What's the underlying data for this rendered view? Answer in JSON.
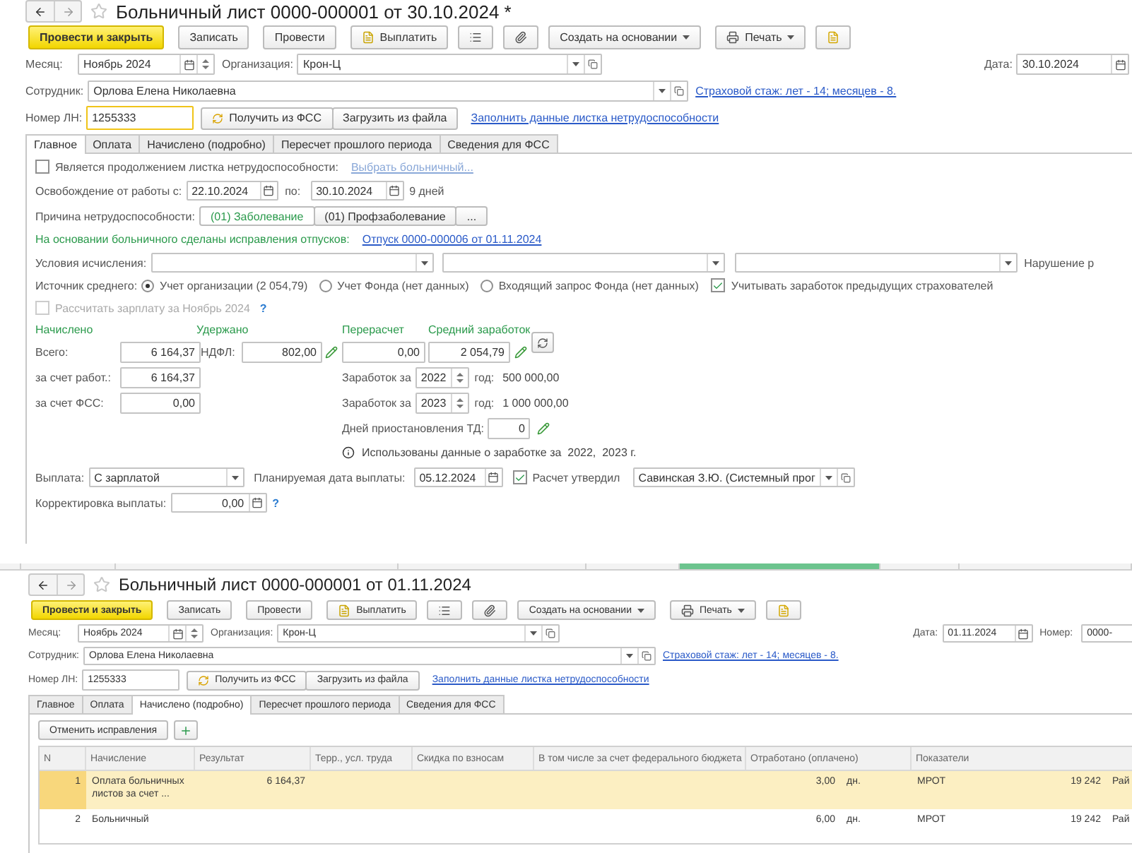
{
  "documents": [
    {
      "title": "Больничный лист 0000-000001 от 30.10.2024 *",
      "toolbar": [
        {
          "kind": "primary",
          "label": "Провести и закрыть"
        },
        {
          "kind": "button",
          "label": "Записать"
        },
        {
          "kind": "button",
          "label": "Провести"
        },
        {
          "kind": "pay",
          "label": "Выплатить"
        },
        {
          "kind": "list"
        },
        {
          "kind": "clip"
        },
        {
          "kind": "menu",
          "label": "Создать на основании"
        },
        {
          "kind": "print",
          "label": "Печать"
        },
        {
          "kind": "report"
        }
      ],
      "month": {
        "label": "Месяц:",
        "value": "Ноябрь 2024"
      },
      "organization": {
        "label": "Организация:",
        "value": "Крон-Ц"
      },
      "date": {
        "label": "Дата:",
        "value": "30.10.2024"
      },
      "employee": {
        "label": "Сотрудник:",
        "value": "Орлова Елена Николаевна"
      },
      "insurance_link": "Страховой стаж: лет - 14; месяцев - 8.",
      "sick_number": {
        "label": "Номер ЛН:",
        "value": "1255333",
        "focused": true
      },
      "fss_button": "Получить из ФСС",
      "file_button": "Загрузить из файла",
      "fill_link": "Заполнить данные листка нетрудоспособности",
      "tabs": [
        {
          "label": "Главное",
          "selected": true
        },
        {
          "label": "Оплата",
          "selected": false
        },
        {
          "label": "Начислено (подробно)",
          "selected": false
        },
        {
          "label": "Пересчет прошлого периода",
          "selected": false
        },
        {
          "label": "Сведения для ФСС",
          "selected": false
        }
      ],
      "main": {
        "continuation": {
          "label": "Является продолжением листка нетрудоспособности:",
          "checked": false,
          "link": "Выбрать больничный..."
        },
        "release": {
          "label": "Освобождение от работы с:",
          "from": "22.10.2024",
          "to_label": "по:",
          "to": "30.10.2024",
          "days": "9 дней"
        },
        "cause": {
          "label": "Причина нетрудоспособности:",
          "options": [
            {
              "label": "(01) Заболевание",
              "selected": true
            },
            {
              "label": "(01) Профзаболевание",
              "selected": false
            }
          ],
          "more": "..."
        },
        "notice": {
          "text": "На основании больничного сделаны исправления отпусков:",
          "link": "Отпуск 0000-000006 от 01.11.2024"
        },
        "conditions": {
          "label": "Условия исчисления:",
          "right_label": "Нарушение р"
        },
        "average_source": {
          "label": "Источник среднего:",
          "options": [
            {
              "label": "Учет организации (2 054,79)",
              "selected": true
            },
            {
              "label": "Учет Фонда (нет данных)",
              "selected": false
            },
            {
              "label": "Входящий запрос Фонда (нет данных)",
              "selected": false
            }
          ],
          "previous_insurers": {
            "label": "Учитывать заработок предыдущих страхователей",
            "checked": true
          }
        },
        "recalc_salary": {
          "label": "Рассчитать зарплату за Ноябрь 2024",
          "checked": false,
          "disabled": true,
          "help": "?"
        },
        "amounts": {
          "headings": [
            "Начислено",
            "Удержано",
            "Перерасчет",
            "Средний заработок"
          ],
          "total_label": "Всего:",
          "total": "6 164,37",
          "ndfl_label": "НДФЛ:",
          "ndfl": "802,00",
          "recalculation": "0,00",
          "average": "2 054,79",
          "employer_label": "за счет работ.:",
          "employer": "6 164,37",
          "fss_label": "за счет ФСС:",
          "fss": "0,00"
        },
        "earnings": [
          {
            "label": "Заработок за",
            "year": "2022",
            "suffix": "год:",
            "amount": "500 000,00"
          },
          {
            "label": "Заработок за",
            "year": "2023",
            "suffix": "год:",
            "amount": "1 000 000,00"
          }
        ],
        "downtime": {
          "label": "Дней приостановления ТД:",
          "value": "0"
        },
        "info": "Использованы данные о заработке за  2022,  2023 г.",
        "payment": {
          "label": "Выплата:",
          "value": "С зарплатой",
          "planned_label": "Планируемая дата выплаты:",
          "planned": "05.12.2024",
          "approved": {
            "label": "Расчет утвердил",
            "checked": true
          },
          "approver": "Савинская З.Ю. (Системный прог"
        },
        "correction": {
          "label": "Корректировка выплаты:",
          "value": "0,00",
          "help": "?"
        }
      }
    },
    {
      "title": "Больничный лист 0000-000001 от 01.11.2024",
      "toolbar": [
        {
          "kind": "primary",
          "label": "Провести и закрыть"
        },
        {
          "kind": "button",
          "label": "Записать"
        },
        {
          "kind": "button",
          "label": "Провести"
        },
        {
          "kind": "pay",
          "label": "Выплатить"
        },
        {
          "kind": "list"
        },
        {
          "kind": "clip"
        },
        {
          "kind": "menu",
          "label": "Создать на основании"
        },
        {
          "kind": "print",
          "label": "Печать"
        },
        {
          "kind": "report"
        }
      ],
      "month": {
        "label": "Месяц:",
        "value": "Ноябрь 2024"
      },
      "organization": {
        "label": "Организация:",
        "value": "Крон-Ц"
      },
      "date": {
        "label": "Дата:",
        "value": "01.11.2024"
      },
      "number": {
        "label": "Номер:",
        "value": "0000-"
      },
      "employee": {
        "label": "Сотрудник:",
        "value": "Орлова Елена Николаевна"
      },
      "insurance_link": "Страховой стаж: лет - 14; месяцев - 8.",
      "sick_number": {
        "label": "Номер ЛН:",
        "value": "1255333",
        "focused": false
      },
      "fss_button": "Получить из ФСС",
      "file_button": "Загрузить из файла",
      "fill_link": "Заполнить данные листка нетрудоспособности",
      "tabs": [
        {
          "label": "Главное",
          "selected": false
        },
        {
          "label": "Оплата",
          "selected": false
        },
        {
          "label": "Начислено (подробно)",
          "selected": true
        },
        {
          "label": "Пересчет прошлого периода",
          "selected": false
        },
        {
          "label": "Сведения для ФСС",
          "selected": false
        }
      ],
      "accruals": {
        "cancel_button": "Отменить исправления",
        "columns": [
          "N",
          "Начисление",
          "Результат",
          "Терр., усл. труда",
          "Скидка по взносам",
          "В том числе за счет федерального бюджета",
          "Отработано (оплачено)",
          "Показатели"
        ],
        "rows": [
          {
            "selected": true,
            "n": "1",
            "accrual": "Оплата больничных листов за счет ...",
            "result": "6 164,37",
            "worked": "3,00",
            "unit": "дн.",
            "indicator": "МРОТ",
            "indicator_value": "19 242",
            "extra": "Рай"
          },
          {
            "selected": false,
            "n": "2",
            "accrual": "Больничный",
            "worked": "6,00",
            "unit": "дн.",
            "indicator": "МРОТ",
            "indicator_value": "19 242",
            "extra": "Рай"
          }
        ]
      }
    }
  ],
  "window_tabs": [
    {
      "selected": false
    },
    {
      "selected": false
    },
    {
      "selected": false
    },
    {
      "selected": false
    },
    {
      "selected": false
    },
    {
      "selected": true
    },
    {
      "selected": false
    },
    {
      "selected": false
    }
  ]
}
